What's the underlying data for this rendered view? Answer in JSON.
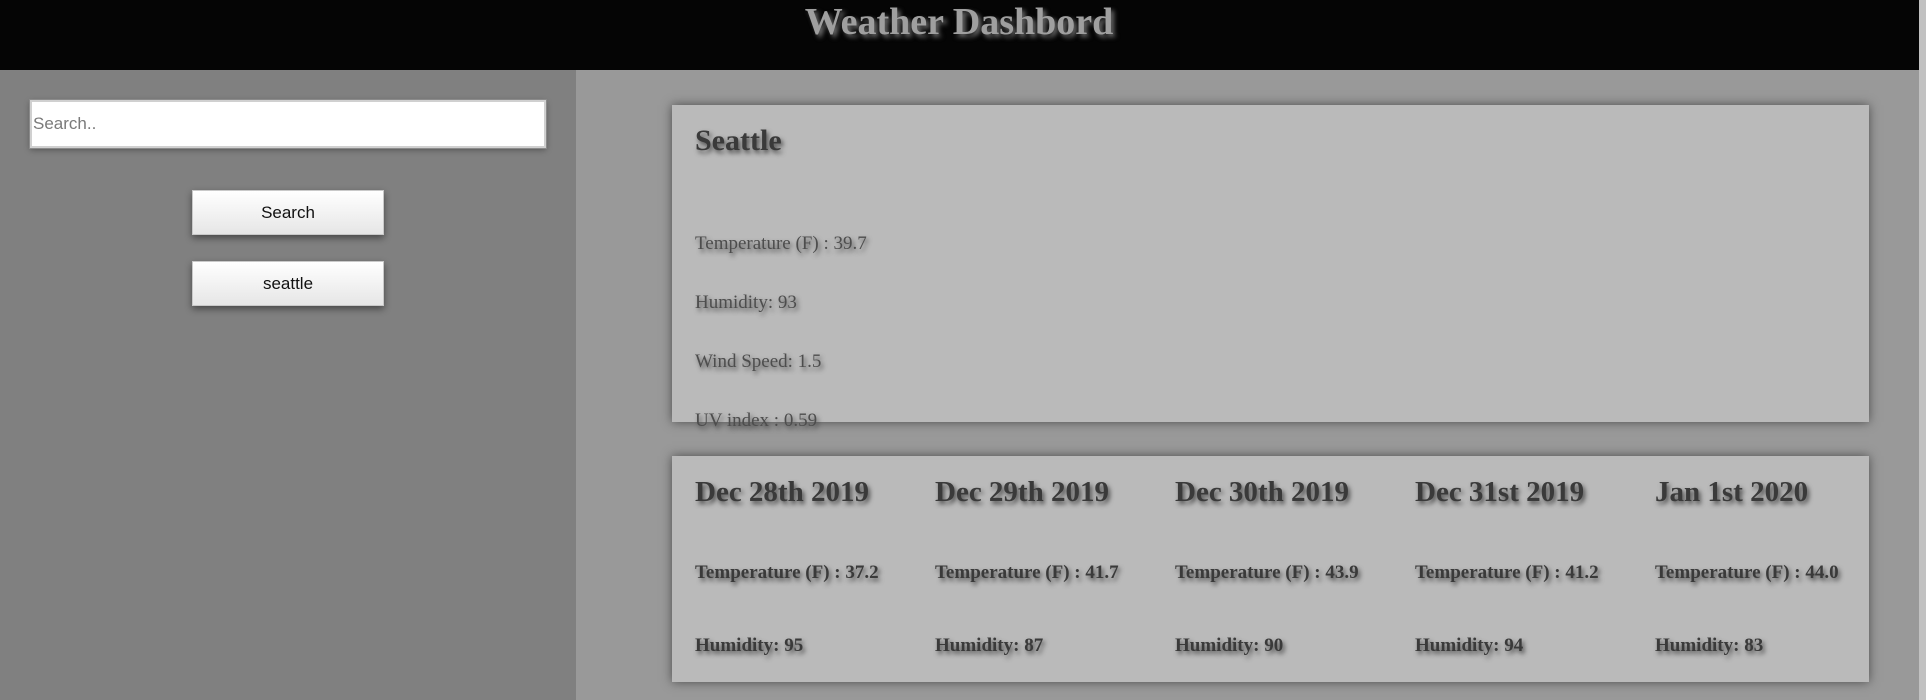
{
  "header": {
    "title": "Weather Dashbord"
  },
  "sidebar": {
    "search_placeholder": "Search..",
    "search_value": "",
    "search_button_label": "Search",
    "history": [
      {
        "label": "seattle"
      }
    ]
  },
  "current": {
    "city": "Seattle",
    "temperature": "Temperature (F) : 39.7",
    "humidity": "Humidity: 93",
    "wind_speed": "Wind Speed: 1.5",
    "uv_index": "UV index : 0.59"
  },
  "forecast": [
    {
      "date": "Dec 28th 2019",
      "temperature": "Temperature (F) : 37.2",
      "humidity": "Humidity: 95"
    },
    {
      "date": "Dec 29th 2019",
      "temperature": "Temperature (F) : 41.7",
      "humidity": "Humidity: 87"
    },
    {
      "date": "Dec 30th 2019",
      "temperature": "Temperature (F) : 43.9",
      "humidity": "Humidity: 90"
    },
    {
      "date": "Dec 31st 2019",
      "temperature": "Temperature (F) : 41.2",
      "humidity": "Humidity: 94"
    },
    {
      "date": "Jan 1st 2020",
      "temperature": "Temperature (F) : 44.0",
      "humidity": "Humidity: 83"
    }
  ],
  "colors": {
    "header_bg": "#050505",
    "sidebar_bg": "#808080",
    "main_bg": "#999999",
    "card_bg": "#bababa"
  }
}
